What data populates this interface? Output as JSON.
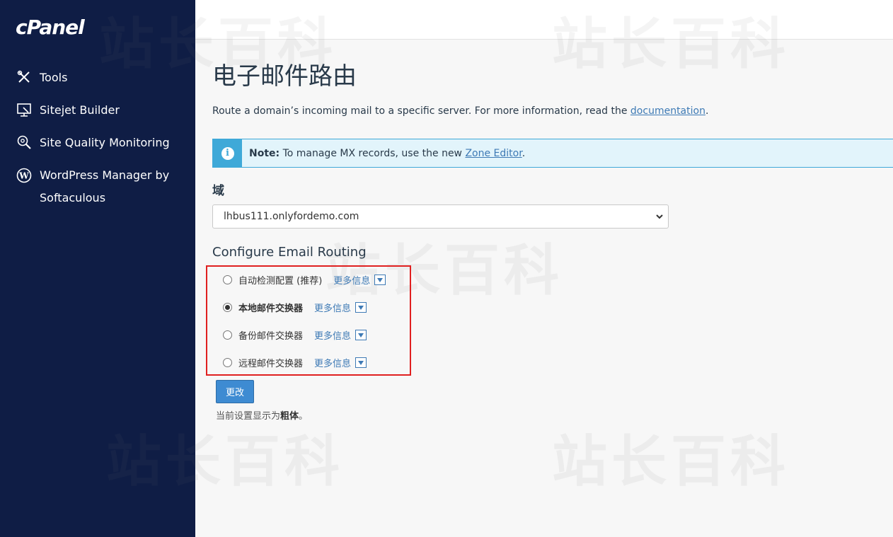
{
  "sidebar": {
    "logo": "cPanel",
    "items": [
      {
        "label": "Tools",
        "icon": "tools-icon"
      },
      {
        "label": "Sitejet Builder",
        "icon": "sitejet-icon"
      },
      {
        "label": "Site Quality Monitoring",
        "icon": "magnifier-gear-icon"
      },
      {
        "label": "WordPress Manager by Softaculous",
        "icon": "wordpress-icon"
      }
    ]
  },
  "main": {
    "title": "电子邮件路由",
    "description": {
      "text": "Route a domain’s incoming mail to a specific server. For more information, read the ",
      "link": "documentation",
      "suffix": "."
    },
    "alert": {
      "bold": "Note:",
      "text": " To manage MX records, use the new ",
      "link": "Zone Editor",
      "suffix": "."
    },
    "domain_label": "域",
    "domain_value": "lhbus111.onlyfordemo.com",
    "section_title": "Configure Email Routing",
    "options": [
      {
        "label": "自动检测配置 (推荐)",
        "more": "更多信息",
        "checked": false
      },
      {
        "label": "本地邮件交换器",
        "more": "更多信息",
        "checked": true
      },
      {
        "label": "备份邮件交换器",
        "more": "更多信息",
        "checked": false
      },
      {
        "label": "远程邮件交换器",
        "more": "更多信息",
        "checked": false
      }
    ],
    "submit_label": "更改",
    "hint": {
      "text": "当前设置显示为",
      "bold": "粗体",
      "suffix": "。"
    }
  },
  "watermark": "站长百科",
  "colors": {
    "sidebar_bg": "#0f1d45",
    "accent": "#3e8bd2",
    "alert_bg": "#e2f4fb",
    "alert_border": "#3fa9d8",
    "highlight": "#e02020",
    "link": "#3e7ab5"
  }
}
